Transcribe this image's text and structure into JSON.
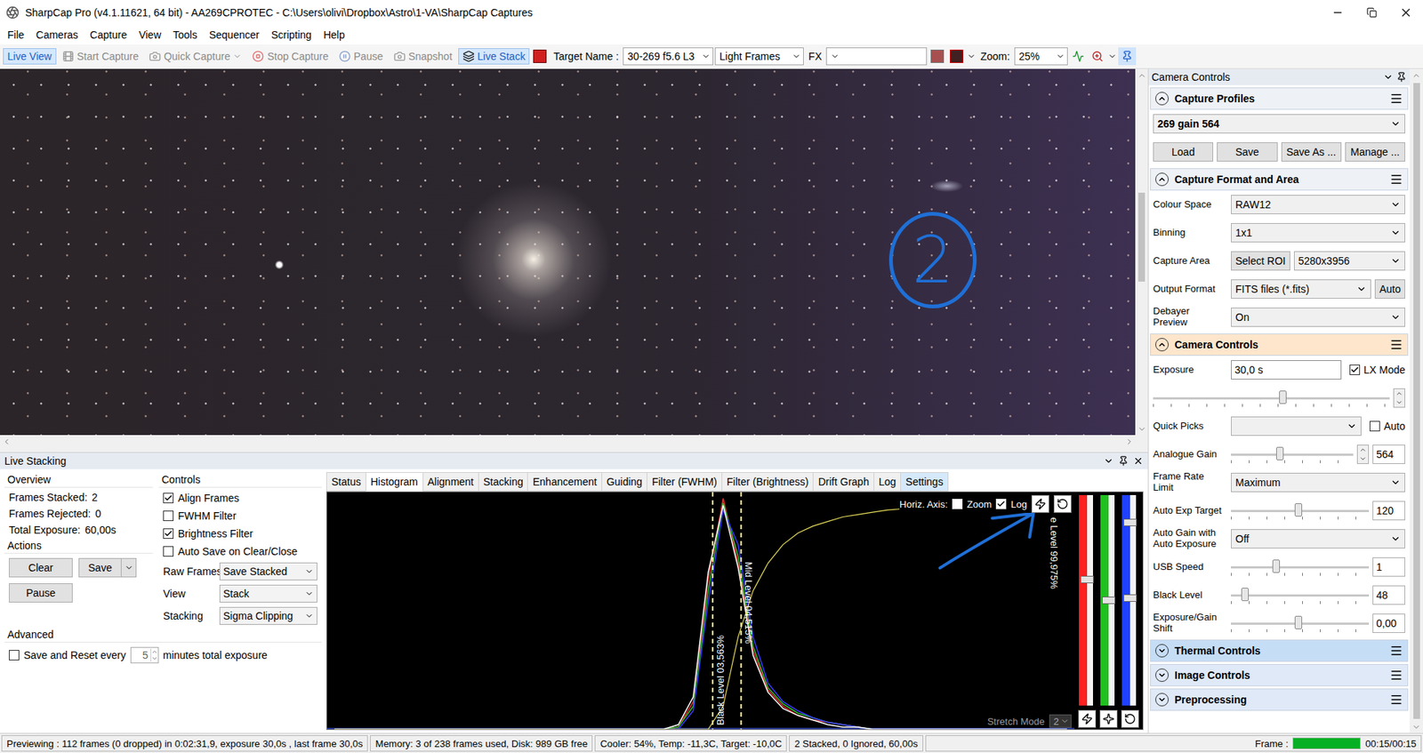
{
  "window": {
    "title": "SharpCap Pro (v4.1.11621, 64 bit) - AA269CPROTEC - C:\\Users\\olivi\\Dropbox\\Astro\\1-VA\\SharpCap Captures"
  },
  "menu": [
    "File",
    "Cameras",
    "Capture",
    "View",
    "Tools",
    "Sequencer",
    "Scripting",
    "Help"
  ],
  "toolbar": {
    "buttons": [
      {
        "label": "Live View",
        "kind": "view",
        "selected": true,
        "disabled": false,
        "has_menu": false
      },
      {
        "label": "Start Capture",
        "kind": "capture",
        "selected": false,
        "disabled": true,
        "has_menu": false
      },
      {
        "label": "Quick Capture",
        "kind": "quick",
        "selected": false,
        "disabled": true,
        "has_menu": true
      },
      {
        "label": "Stop Capture",
        "kind": "stop",
        "selected": false,
        "disabled": true,
        "has_menu": false
      },
      {
        "label": "Pause",
        "kind": "pause",
        "selected": false,
        "disabled": true,
        "has_menu": false
      },
      {
        "label": "Snapshot",
        "kind": "snapshot",
        "selected": false,
        "disabled": true,
        "has_menu": false
      },
      {
        "label": "Live Stack",
        "kind": "stack",
        "selected": true,
        "disabled": false,
        "has_menu": false
      }
    ],
    "target": {
      "label": "Target Name :",
      "value": "30-269 f5.6 L3"
    },
    "frame_type": {
      "value": "Light Frames"
    },
    "fx": {
      "label": "FX",
      "value": ""
    },
    "zoom": {
      "label": "Zoom:",
      "value": "25%"
    }
  },
  "image": {
    "annotation": "2"
  },
  "live_stacking": {
    "title": "Live Stacking",
    "overview": {
      "title": "Overview",
      "rows": [
        {
          "label": "Frames Stacked:",
          "value": "2"
        },
        {
          "label": "Frames Rejected:",
          "value": "0"
        },
        {
          "label": "Total Exposure:",
          "value": "60,00s"
        }
      ]
    },
    "actions": {
      "title": "Actions",
      "clear": "Clear",
      "save": "Save",
      "pause": "Pause"
    },
    "advanced": {
      "title": "Advanced",
      "label": "Save and Reset every",
      "checked": false,
      "value": "5",
      "suffix": "minutes total exposure"
    },
    "controls": {
      "title": "Controls",
      "checks": [
        {
          "label": "Align Frames",
          "checked": true
        },
        {
          "label": "FWHM Filter",
          "checked": false
        },
        {
          "label": "Brightness Filter",
          "checked": true
        },
        {
          "label": "Auto Save on Clear/Close",
          "checked": false
        }
      ],
      "selects": [
        {
          "label": "Raw Frames",
          "value": "Save Stacked"
        },
        {
          "label": "View",
          "value": "Stack"
        },
        {
          "label": "Stacking",
          "value": "Sigma Clipping"
        }
      ]
    },
    "tabs": [
      {
        "label": "Status",
        "selected": false,
        "highlighted": false
      },
      {
        "label": "Histogram",
        "selected": true,
        "highlighted": false
      },
      {
        "label": "Alignment",
        "selected": false,
        "highlighted": false
      },
      {
        "label": "Stacking",
        "selected": false,
        "highlighted": false
      },
      {
        "label": "Enhancement",
        "selected": false,
        "highlighted": false
      },
      {
        "label": "Guiding",
        "selected": false,
        "highlighted": false
      },
      {
        "label": "Filter (FWHM)",
        "selected": false,
        "highlighted": false
      },
      {
        "label": "Filter (Brightness)",
        "selected": false,
        "highlighted": false
      },
      {
        "label": "Drift Graph",
        "selected": false,
        "highlighted": false
      },
      {
        "label": "Log",
        "selected": false,
        "highlighted": false
      },
      {
        "label": "Settings",
        "selected": false,
        "highlighted": true
      }
    ],
    "histogram": {
      "horiz_label": "Horiz. Axis:",
      "zoom": {
        "label": "Zoom",
        "checked": false
      },
      "log": {
        "label": "Log",
        "checked": true
      },
      "series": [
        {
          "name": "red",
          "color": "#e83030",
          "values": [
            0,
            0,
            0,
            0,
            0,
            0,
            0,
            0,
            0,
            0,
            0,
            0,
            0,
            0,
            0,
            0,
            0,
            0,
            0,
            0,
            0,
            0,
            0,
            1,
            12,
            65,
            100,
            72,
            34,
            17,
            10,
            6,
            4,
            3,
            2,
            1,
            0,
            0,
            0,
            0,
            0,
            0,
            0,
            0,
            0,
            0,
            0,
            0,
            0,
            0
          ]
        },
        {
          "name": "green",
          "color": "#30c030",
          "values": [
            0,
            0,
            0,
            0,
            0,
            0,
            0,
            0,
            0,
            0,
            0,
            0,
            0,
            0,
            0,
            0,
            0,
            0,
            0,
            0,
            0,
            0,
            0,
            1,
            10,
            60,
            98,
            75,
            36,
            18,
            11,
            7,
            5,
            3,
            2,
            1,
            0,
            0,
            0,
            0,
            0,
            0,
            0,
            0,
            0,
            0,
            0,
            0,
            0,
            0
          ]
        },
        {
          "name": "blue",
          "color": "#3a3aff",
          "values": [
            0,
            0,
            0,
            0,
            0,
            0,
            0,
            0,
            0,
            0,
            0,
            0,
            0,
            0,
            0,
            0,
            0,
            0,
            0,
            0,
            0,
            0,
            0,
            0,
            8,
            55,
            95,
            80,
            40,
            20,
            12,
            8,
            5,
            3,
            2,
            1,
            0,
            0,
            0,
            0,
            0,
            0,
            0,
            0,
            0,
            0,
            0,
            0,
            0,
            0
          ]
        },
        {
          "name": "luminance",
          "color": "#ffffff",
          "values": [
            0,
            0,
            0,
            0,
            0,
            0,
            0,
            0,
            0,
            0,
            0,
            0,
            0,
            0,
            0,
            0,
            0,
            0,
            0,
            0,
            0,
            0,
            0,
            2,
            14,
            68,
            97,
            70,
            32,
            16,
            9,
            6,
            4,
            2,
            1,
            1,
            0,
            0,
            0,
            0,
            0,
            0,
            0,
            0,
            0,
            0,
            0,
            0,
            0,
            0
          ]
        }
      ],
      "curve": {
        "color": "#e6dc5a",
        "values": [
          0,
          0,
          0,
          0,
          0,
          0,
          0,
          0,
          0,
          0,
          0,
          0,
          0,
          0,
          0,
          0,
          0,
          0,
          0,
          0,
          0,
          0,
          0,
          0,
          0,
          0,
          10,
          40,
          60,
          72,
          80,
          85,
          88,
          90,
          92,
          93,
          94,
          95,
          95.5,
          96,
          96.5,
          97,
          97.3,
          97.6,
          97.9,
          98.1,
          98.3,
          98.5,
          98.7,
          98.9
        ]
      },
      "levels": [
        {
          "label": "Black Level 03,563%",
          "level": 0.516,
          "direction": "up"
        },
        {
          "label": "Mid Level 04,515%",
          "level": 0.554,
          "direction": "down"
        },
        {
          "label": "e Level 99,975%",
          "level": 0.985,
          "direction": "down"
        }
      ],
      "stretch": {
        "label": "Stretch Mode",
        "value": "2"
      },
      "sliders": [
        {
          "color": "#ff2020",
          "levels": [
            0.4
          ]
        },
        {
          "color": "#20c020",
          "levels": [
            0.5
          ]
        },
        {
          "color": "#2040ff",
          "levels": [
            0.13,
            0.49
          ]
        }
      ]
    }
  },
  "camera_controls": {
    "title": "Camera Controls",
    "sections": [
      {
        "title": "Capture Profiles",
        "kind": "profiles",
        "expanded": true,
        "highlighted": false,
        "hovered": false,
        "profile": "269 gain 564",
        "buttons": [
          "Load",
          "Save",
          "Save As ...",
          "Manage ..."
        ],
        "rows": []
      },
      {
        "title": "Capture Format and Area",
        "kind": "rows",
        "expanded": true,
        "highlighted": false,
        "hovered": false,
        "rows": [
          {
            "kind": "select",
            "label": [
              "Colour Space"
            ],
            "value": "RAW12"
          },
          {
            "kind": "select",
            "label": [
              "Binning"
            ],
            "value": "1x1"
          },
          {
            "kind": "roi",
            "label": [
              "Capture Area"
            ],
            "button": "Select ROI",
            "value": "5280x3956"
          },
          {
            "kind": "select_button",
            "label": [
              "Output Format"
            ],
            "value": "FITS files (*.fits)",
            "button": "Auto"
          },
          {
            "kind": "select",
            "label": [
              "Debayer",
              "Preview"
            ],
            "value": "On"
          }
        ]
      },
      {
        "title": "Camera Controls",
        "kind": "rows",
        "expanded": true,
        "highlighted": true,
        "hovered": false,
        "rows": [
          {
            "kind": "exposure",
            "label": [
              "Exposure"
            ],
            "value": "30,0 s",
            "check": {
              "label": "LX Mode",
              "checked": true
            }
          },
          {
            "kind": "exp_slider",
            "level": 0.55
          },
          {
            "kind": "quick",
            "label": [
              "Quick Picks"
            ],
            "value": "",
            "check": {
              "label": "Auto",
              "checked": false
            }
          },
          {
            "kind": "slider",
            "label": [
              "Analogue Gain"
            ],
            "level": 0.4,
            "value": "564",
            "spinner": true
          },
          {
            "kind": "select",
            "label": [
              "Frame Rate",
              "Limit"
            ],
            "value": "Maximum"
          },
          {
            "kind": "slider",
            "label": [
              "Auto Exp Target"
            ],
            "level": 0.49,
            "value": "120",
            "spinner": false
          },
          {
            "kind": "select",
            "label": [
              "Auto Gain with",
              "Auto Exposure"
            ],
            "value": "Off"
          },
          {
            "kind": "slider",
            "label": [
              "USB Speed"
            ],
            "level": 0.33,
            "value": "1",
            "spinner": false
          },
          {
            "kind": "slider",
            "label": [
              "Black Level"
            ],
            "level": 0.1,
            "value": "48",
            "spinner": false
          },
          {
            "kind": "slider",
            "label": [
              "Exposure/Gain",
              "Shift"
            ],
            "level": 0.49,
            "value": "0,00",
            "spinner": false
          }
        ]
      },
      {
        "title": "Thermal Controls",
        "kind": "rows",
        "expanded": false,
        "highlighted": false,
        "hovered": true,
        "rows": []
      },
      {
        "title": "Image Controls",
        "kind": "rows",
        "expanded": false,
        "highlighted": false,
        "hovered": false,
        "rows": []
      },
      {
        "title": "Preprocessing",
        "kind": "rows",
        "expanded": false,
        "highlighted": false,
        "hovered": false,
        "rows": []
      }
    ]
  },
  "status_bar": {
    "preview": "Previewing : 112 frames (0 dropped) in 0:02:31,9, exposure 30,0s , last frame 30,0s",
    "memory": "Memory: 3 of 238 frames used, Disk: 989 GB free",
    "cooler": "Cooler: 54%, Temp: -11,3C, Target: -10,0C",
    "stacked": "2 Stacked, 0 Ignored, 60,00s",
    "frame_label": "Frame :",
    "frame_level": 1.0,
    "frame_time": "00:15/00:15"
  }
}
